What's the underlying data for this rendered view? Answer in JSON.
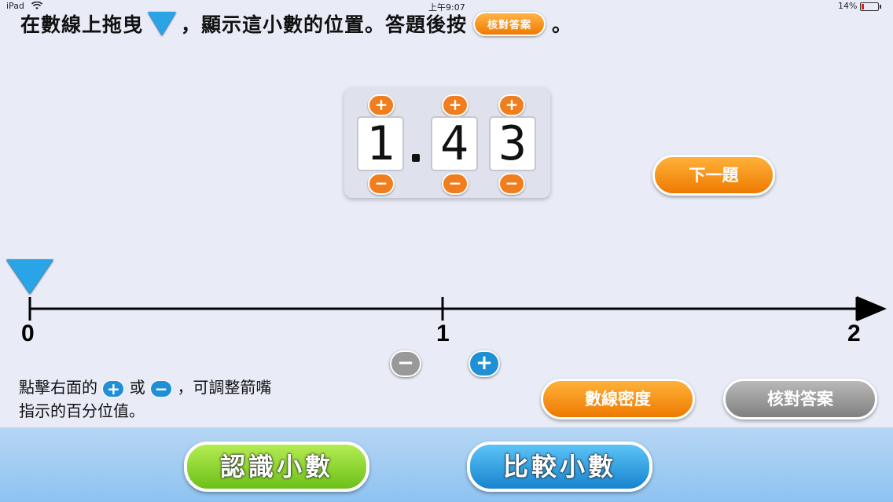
{
  "status_bar": {
    "device": "iPad",
    "time": "上午9:07",
    "battery": "14%"
  },
  "instruction": {
    "part1": "在數線上拖曳",
    "part2": "，顯示這小數的位置。答題後按",
    "inline_button": "核對答案",
    "end": "。"
  },
  "decimal": {
    "ones": "1",
    "tenths": "4",
    "hundredths": "3"
  },
  "buttons": {
    "next": "下一題",
    "density": "數線密度",
    "check": "核對答案"
  },
  "number_line": {
    "labels": [
      "0",
      "1",
      "2"
    ],
    "pointer_value": 0
  },
  "help": {
    "line1_a": "點擊右面的",
    "line1_b": "或",
    "line1_c": "，可調整箭嘴",
    "line2": "指示的百分位值。"
  },
  "nav": {
    "learn": "認識小數",
    "compare": "比較小數"
  },
  "icons": {
    "plus": "+",
    "minus": "−"
  },
  "colors": {
    "orange": "#ef7a00",
    "blue_pointer": "#29a4e6",
    "green": "#7dcc2a",
    "blue_btn": "#1f8fd6"
  }
}
